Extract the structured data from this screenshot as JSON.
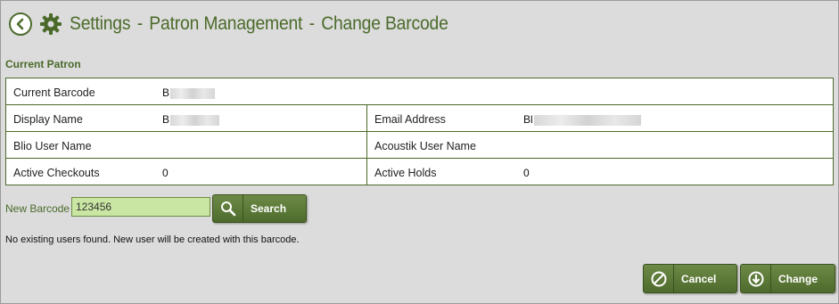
{
  "header": {
    "title_parts": [
      "Settings",
      "-",
      "Patron Management",
      "-",
      "Change Barcode"
    ],
    "back_icon": "back-arrow-icon",
    "settings_icon": "gear-icon"
  },
  "section": {
    "label": "Current Patron"
  },
  "patron": {
    "current_barcode_label": "Current Barcode",
    "current_barcode_value": "B",
    "display_name_label": "Display Name",
    "display_name_value": "B",
    "email_label": "Email Address",
    "email_value": "Bl",
    "blio_label": "Blio User Name",
    "blio_value": "",
    "acoustik_label": "Acoustik User Name",
    "acoustik_value": "",
    "checkouts_label": "Active Checkouts",
    "checkouts_value": "0",
    "holds_label": "Active Holds",
    "holds_value": "0"
  },
  "new_barcode": {
    "label": "New Barcode",
    "value": "123456",
    "search_label": "Search",
    "search_icon": "search-icon"
  },
  "message": "No existing users found. New user will be created with this barcode.",
  "actions": {
    "cancel_label": "Cancel",
    "cancel_icon": "cancel-icon",
    "change_label": "Change",
    "change_icon": "download-arrow-icon"
  },
  "colors": {
    "brand_green": "#4b6a2a",
    "input_bg": "#c9e6a3",
    "page_bg": "#dcdcdc"
  }
}
